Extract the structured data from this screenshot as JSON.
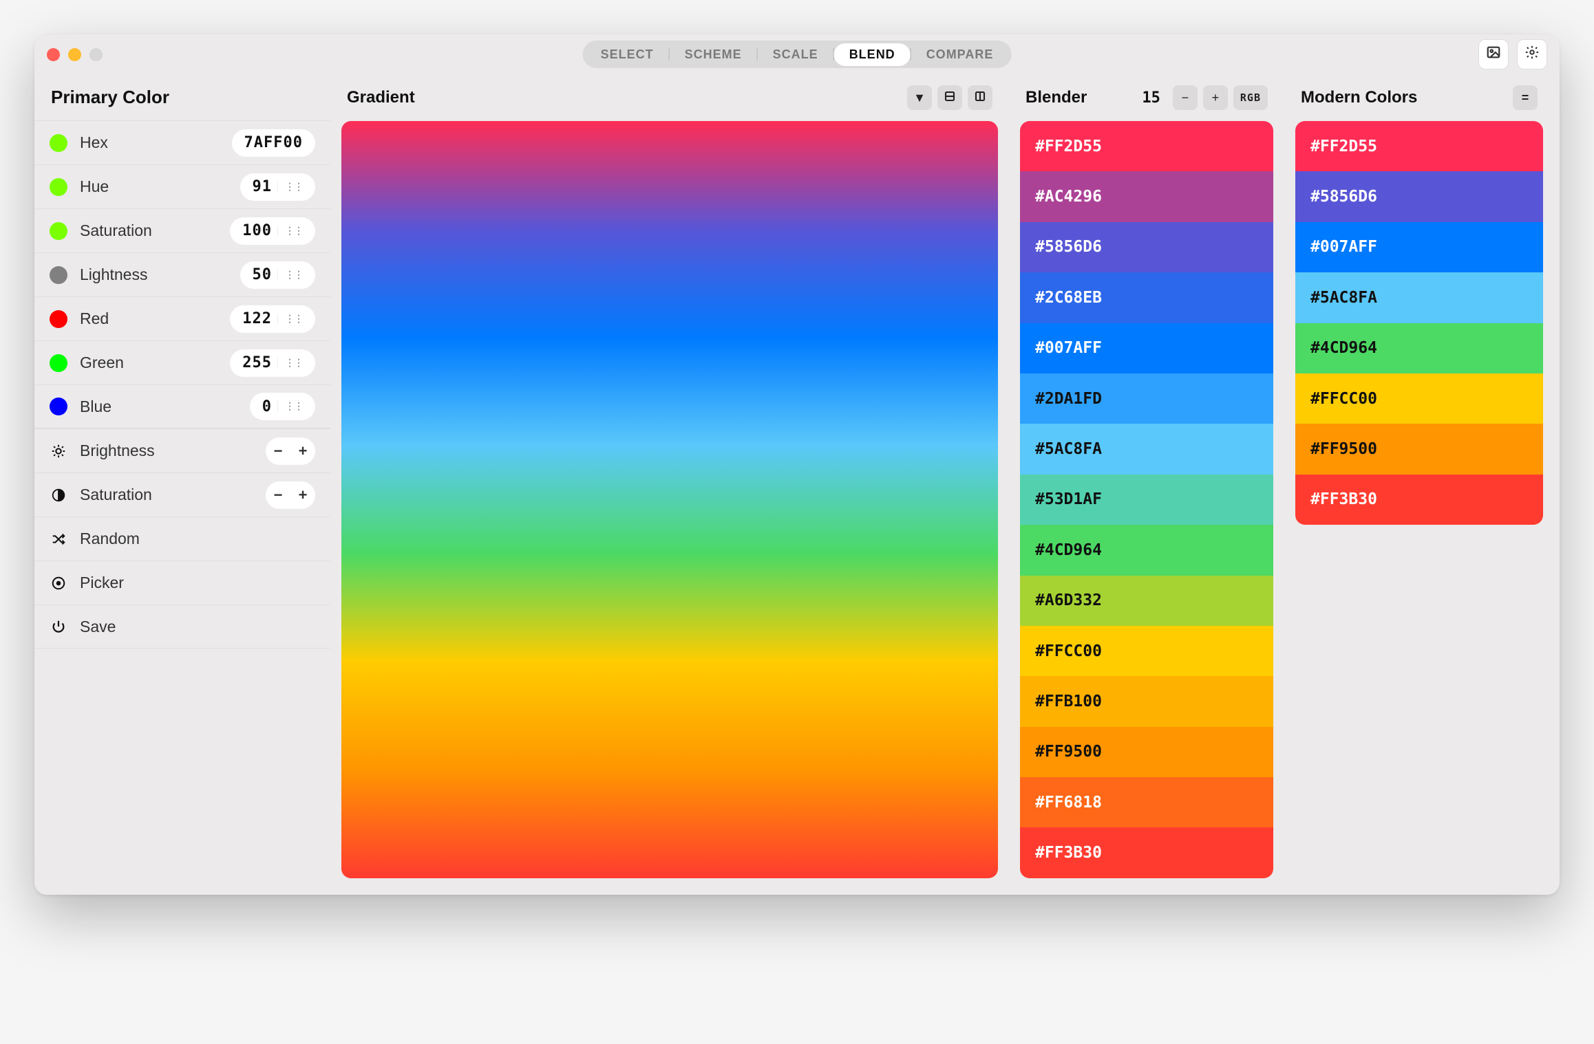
{
  "tabs": {
    "items": [
      "SELECT",
      "SCHEME",
      "SCALE",
      "BLEND",
      "COMPARE"
    ],
    "active_index": 3
  },
  "sidebar": {
    "title": "Primary Color",
    "rows": [
      {
        "id": "hex",
        "label": "Hex",
        "swatch": "#7aff00",
        "value": "7AFF00",
        "kind": "text"
      },
      {
        "id": "hue",
        "label": "Hue",
        "swatch": "#7aff00",
        "value": "91",
        "kind": "slider"
      },
      {
        "id": "saturation",
        "label": "Saturation",
        "swatch": "#7aff00",
        "value": "100",
        "kind": "slider"
      },
      {
        "id": "lightness",
        "label": "Lightness",
        "swatch": "#808080",
        "value": "50",
        "kind": "slider"
      },
      {
        "id": "red",
        "label": "Red",
        "swatch": "#ff0000",
        "value": "122",
        "kind": "slider"
      },
      {
        "id": "green",
        "label": "Green",
        "swatch": "#00ff00",
        "value": "255",
        "kind": "slider"
      },
      {
        "id": "blue",
        "label": "Blue",
        "swatch": "#0000ff",
        "value": "0",
        "kind": "slider"
      }
    ],
    "actions": [
      {
        "id": "brightness",
        "label": "Brightness",
        "icon": "brightness",
        "stepper": true
      },
      {
        "id": "saturation2",
        "label": "Saturation",
        "icon": "contrast",
        "stepper": true
      },
      {
        "id": "random",
        "label": "Random",
        "icon": "shuffle",
        "stepper": false
      },
      {
        "id": "picker",
        "label": "Picker",
        "icon": "target",
        "stepper": false
      },
      {
        "id": "save",
        "label": "Save",
        "icon": "power",
        "stepper": false
      }
    ],
    "stepper_minus": "−",
    "stepper_plus": "+"
  },
  "gradient": {
    "title": "Gradient",
    "stops": [
      "#FF2D55",
      "#5856D6",
      "#007AFF",
      "#5AC8FA",
      "#4CD964",
      "#FFCC00",
      "#FF9500",
      "#FF3B30"
    ]
  },
  "blender": {
    "title": "Blender",
    "count": "15",
    "mode": "RGB",
    "colors": [
      "#FF2D55",
      "#AC4296",
      "#5856D6",
      "#2C68EB",
      "#007AFF",
      "#2DA1FD",
      "#5AC8FA",
      "#53D1AF",
      "#4CD964",
      "#A6D332",
      "#FFCC00",
      "#FFB100",
      "#FF9500",
      "#FF6818",
      "#FF3B30"
    ]
  },
  "modern": {
    "title": "Modern Colors",
    "colors": [
      "#FF2D55",
      "#5856D6",
      "#007AFF",
      "#5AC8FA",
      "#4CD964",
      "#FFCC00",
      "#FF9500",
      "#FF3B30"
    ]
  }
}
